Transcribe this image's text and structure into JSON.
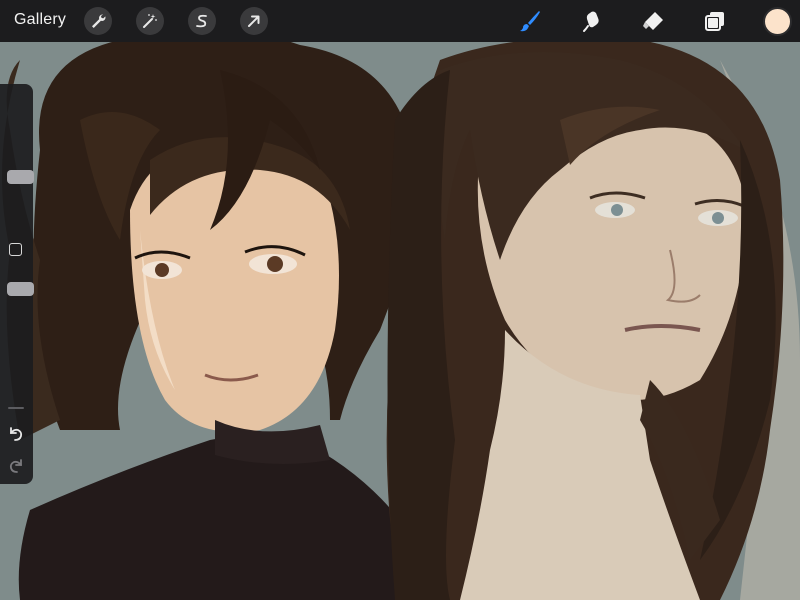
{
  "topbar": {
    "gallery_label": "Gallery",
    "left_tools": [
      {
        "name": "actions",
        "icon": "wrench-icon"
      },
      {
        "name": "adjustments",
        "icon": "magic-wand-icon"
      },
      {
        "name": "selection",
        "icon": "selection-s-icon"
      },
      {
        "name": "transform",
        "icon": "arrow-cursor-icon"
      }
    ],
    "right_tools": [
      {
        "name": "brush",
        "icon": "brush-icon",
        "active": true
      },
      {
        "name": "smudge",
        "icon": "smudge-icon",
        "active": false
      },
      {
        "name": "eraser",
        "icon": "eraser-icon",
        "active": false
      },
      {
        "name": "layers",
        "icon": "layers-icon",
        "active": false
      }
    ],
    "current_color": "#fce3cb"
  },
  "sidebar": {
    "brush_size_level": 0.29,
    "opacity_level": 0.93,
    "icons": [
      "modify-square-icon",
      "undo-icon",
      "redo-icon"
    ]
  },
  "colors": {
    "toolbar_bg": "#1c1c1e",
    "accent": "#2f8cff",
    "canvas_bg": "#7f8c8b"
  }
}
